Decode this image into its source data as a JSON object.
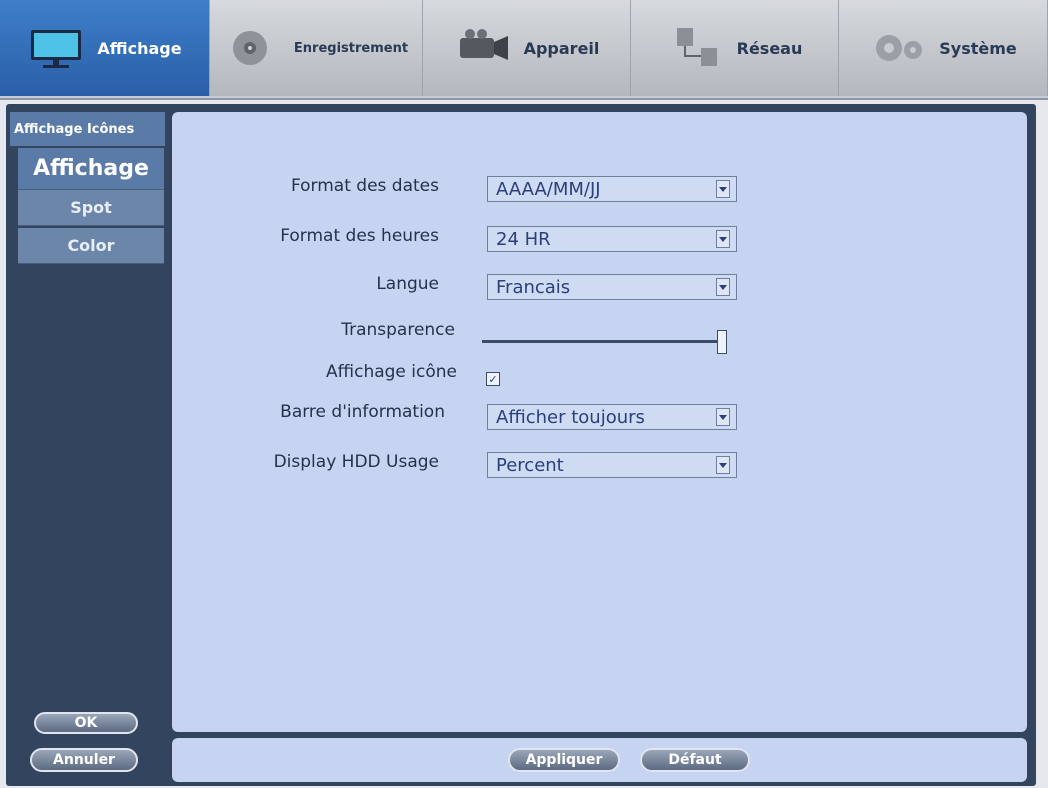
{
  "tabs": [
    {
      "label": "Affichage",
      "icon": "monitor-icon",
      "active": true
    },
    {
      "label": "Enregistrement",
      "icon": "record-disk-icon"
    },
    {
      "label": "Appareil",
      "icon": "camera-icon"
    },
    {
      "label": "Réseau",
      "icon": "network-icon"
    },
    {
      "label": "Système",
      "icon": "gears-icon"
    }
  ],
  "sidebar": {
    "header": "Affichage Icônes",
    "items": [
      {
        "label": "Affichage",
        "active": true
      },
      {
        "label": "Spot"
      },
      {
        "label": "Color"
      }
    ],
    "ok_label": "OK",
    "cancel_label": "Annuler"
  },
  "form": {
    "date_format": {
      "label": "Format des dates",
      "value": "AAAA/MM/JJ"
    },
    "time_format": {
      "label": "Format des heures",
      "value": "24 HR"
    },
    "language": {
      "label": "Langue",
      "value": "Francais"
    },
    "transparency": {
      "label": "Transparence",
      "level": 1.0
    },
    "icon_display": {
      "label": "Affichage icône",
      "checked": true
    },
    "info_bar": {
      "label": "Barre d'information",
      "value": "Afficher toujours"
    },
    "hdd_usage": {
      "label": "Display HDD Usage",
      "value": "Percent"
    }
  },
  "footer": {
    "apply_label": "Appliquer",
    "default_label": "Défaut"
  },
  "colors": {
    "accent": "#2a5fa8",
    "panel": "#33445f",
    "content_bg": "#c6d4f2"
  }
}
